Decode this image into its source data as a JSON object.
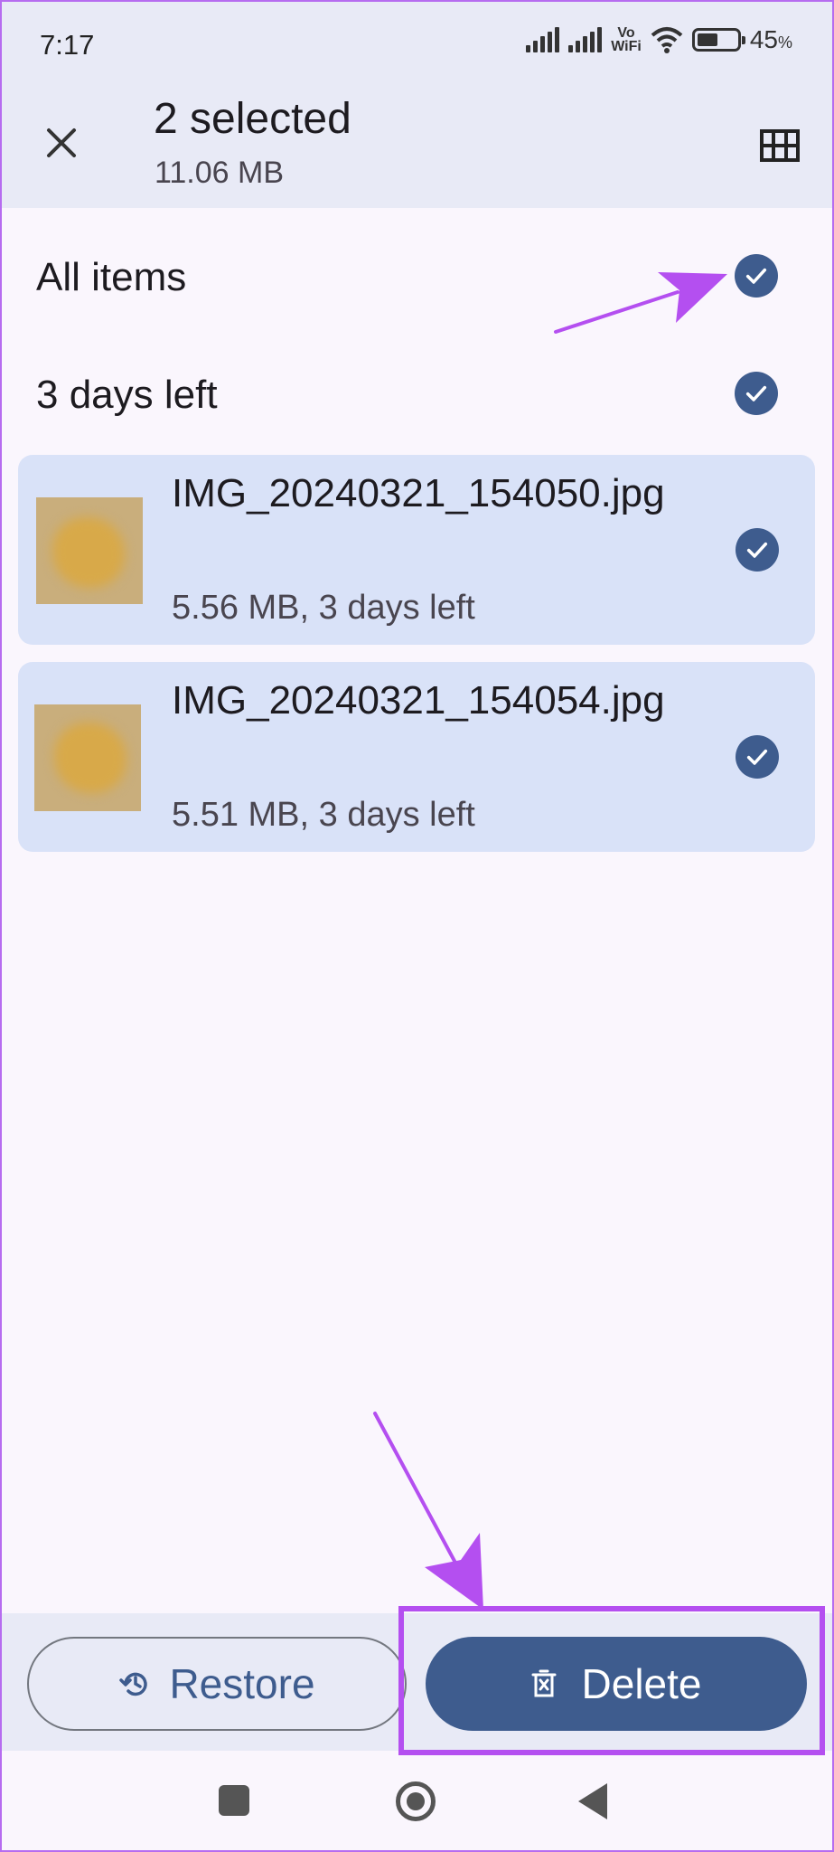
{
  "status_bar": {
    "time": "7:17",
    "network_label_top": "Vo",
    "network_label_bottom": "WiFi",
    "battery_percent": "45",
    "battery_unit": "%",
    "battery_level": 0.45
  },
  "header": {
    "title": "2 selected",
    "subtitle": "11.06 MB",
    "close_icon": "close-icon",
    "grid_icon": "grid-view-icon"
  },
  "sections": {
    "all_items": {
      "label": "All items",
      "checked": true
    },
    "days_left": {
      "label": "3 days left",
      "checked": true
    }
  },
  "files": [
    {
      "name": "IMG_20240321_154050.jpg",
      "meta": "5.56 MB, 3 days left",
      "checked": true
    },
    {
      "name": "IMG_20240321_154054.jpg",
      "meta": "5.51 MB, 3 days left",
      "checked": true
    }
  ],
  "actions": {
    "restore_label": "Restore",
    "delete_label": "Delete"
  },
  "colors": {
    "accent": "#3e5c8e",
    "card_bg": "#d9e2f8",
    "header_bg": "#e8eaf6",
    "annotation": "#b44ff0"
  }
}
